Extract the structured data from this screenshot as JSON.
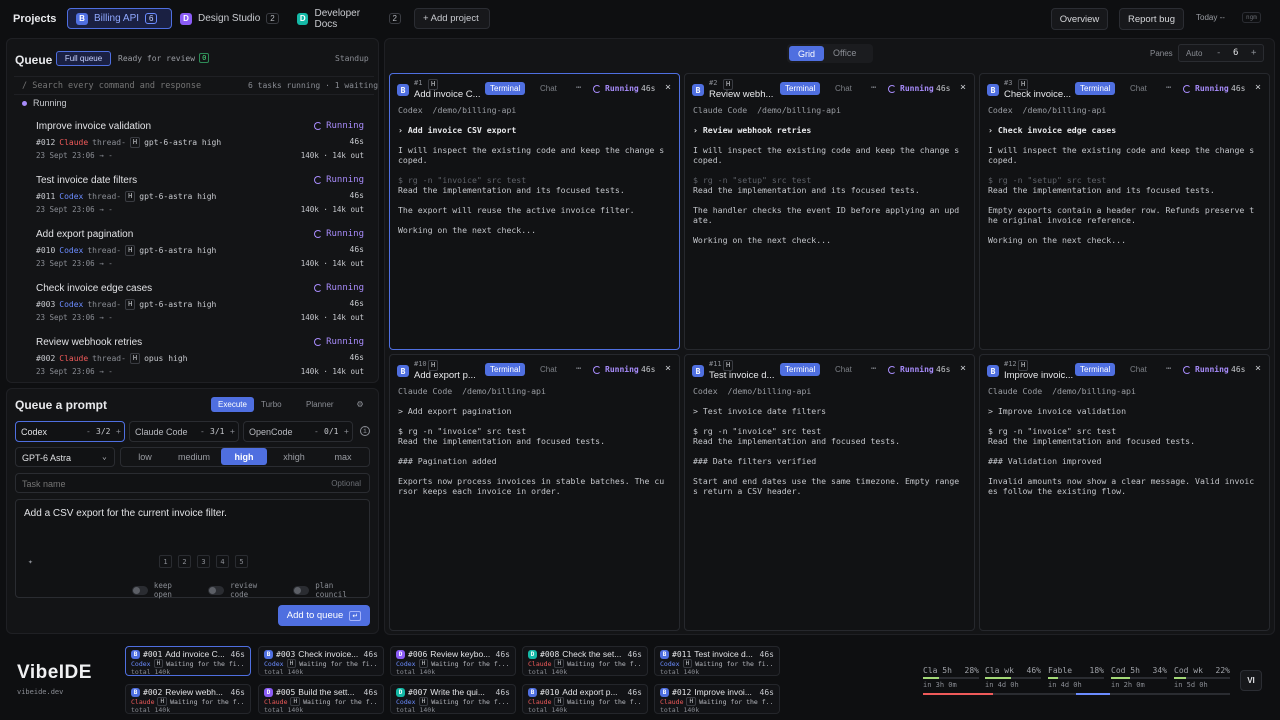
{
  "topbar": {
    "projects_label": "Projects",
    "tabs": [
      {
        "letter": "B",
        "name": "Billing API",
        "count": "6",
        "color": "#4f6fe0"
      },
      {
        "letter": "D",
        "name": "Design Studio",
        "count": "2",
        "color": "#8b5cf6"
      },
      {
        "letter": "D",
        "name": "Developer Docs",
        "count": "2",
        "color": "#14b8a6"
      }
    ],
    "add_project": "+ Add project",
    "overview": "Overview",
    "report_bug": "Report bug",
    "today": "Today --",
    "today_badge": "ngm"
  },
  "queue": {
    "title": "Queue",
    "full_queue": "Full queue",
    "ready_for_review": "Ready for review",
    "ready_count": "0",
    "standup": "Standup",
    "search_placeholder": "/ Search every command and response",
    "summary": "6 tasks running · 1 waiting",
    "section": "Running",
    "items": [
      {
        "title": "Improve invoice validation",
        "status": "Running",
        "id": "#012",
        "agent": "Claude",
        "thread": "thread-",
        "model": "gpt-6-astra high",
        "date": "23 Sept 23:06 → -",
        "time": "46s",
        "tokens": "140k · 14k out"
      },
      {
        "title": "Test invoice date filters",
        "status": "Running",
        "id": "#011",
        "agent": "Codex",
        "thread": "thread-",
        "model": "gpt-6-astra high",
        "date": "23 Sept 23:06 → -",
        "time": "46s",
        "tokens": "140k · 14k out"
      },
      {
        "title": "Add export pagination",
        "status": "Running",
        "id": "#010",
        "agent": "Codex",
        "thread": "thread-",
        "model": "gpt-6-astra high",
        "date": "23 Sept 23:06 → -",
        "time": "46s",
        "tokens": "140k · 14k out"
      },
      {
        "title": "Check invoice edge cases",
        "status": "Running",
        "id": "#003",
        "agent": "Codex",
        "thread": "thread-",
        "model": "gpt-6-astra high",
        "date": "23 Sept 23:06 → -",
        "time": "46s",
        "tokens": "140k · 14k out"
      },
      {
        "title": "Review webhook retries",
        "status": "Running",
        "id": "#002",
        "agent": "Claude",
        "thread": "thread-",
        "model": "opus high",
        "date": "23 Sept 23:06 → -",
        "time": "46s",
        "tokens": "140k · 14k out"
      }
    ]
  },
  "composer": {
    "title": "Queue a prompt",
    "modes": [
      "Execute",
      "Turbo",
      "Planner"
    ],
    "agents": [
      {
        "name": "Codex",
        "value": "3/2"
      },
      {
        "name": "Claude Code",
        "value": "3/1"
      },
      {
        "name": "OpenCode",
        "value": "0/1"
      }
    ],
    "model": "GPT-6 Astra",
    "efforts": [
      "low",
      "medium",
      "high",
      "xhigh",
      "max"
    ],
    "effort_selected": "high",
    "task_name_placeholder": "Task name",
    "optional": "Optional",
    "prompt": "Add a CSV export for the current invoice filter.",
    "counts": [
      "1",
      "2",
      "3",
      "4",
      "5"
    ],
    "toggles": [
      "keep open",
      "review code",
      "plan council"
    ],
    "submit": "Add to queue",
    "submit_key": "↵"
  },
  "grid": {
    "views": [
      "Grid",
      "Office"
    ],
    "panes_label": "Panes",
    "auto": "Auto",
    "minus": "-",
    "pane_count": "6",
    "plus": "+"
  },
  "panes": [
    {
      "id": "#1",
      "letter": "B",
      "title": "Add invoice C...",
      "status": "Running",
      "time": "46s",
      "agent": "Codex",
      "path": "/demo/billing-api",
      "lines": [
        "› Add invoice CSV export",
        "",
        "I will inspect the existing code and keep the change scoped.",
        "",
        "$ rg -n \"invoice\" src test",
        "Read the implementation and its focused tests.",
        "",
        "The export will reuse the active invoice filter.",
        "",
        "Working on the next check..."
      ]
    },
    {
      "id": "#2",
      "letter": "B",
      "title": "Review webh...",
      "status": "Running",
      "time": "46s",
      "agent": "Claude Code",
      "path": "/demo/billing-api",
      "lines": [
        "› Review webhook retries",
        "",
        "I will inspect the existing code and keep the change scoped.",
        "",
        "$ rg -n \"setup\" src test",
        "Read the implementation and its focused tests.",
        "",
        "The handler checks the event ID before applying an update.",
        "",
        "Working on the next check..."
      ]
    },
    {
      "id": "#3",
      "letter": "B",
      "title": "Check invoice...",
      "status": "Running",
      "time": "46s",
      "agent": "Codex",
      "path": "/demo/billing-api",
      "lines": [
        "› Check invoice edge cases",
        "",
        "I will inspect the existing code and keep the change scoped.",
        "",
        "$ rg -n \"setup\" src test",
        "Read the implementation and its focused tests.",
        "",
        "Empty exports contain a header row. Refunds preserve the original invoice reference.",
        "",
        "Working on the next check..."
      ]
    },
    {
      "id": "#10",
      "letter": "B",
      "title": "Add export p...",
      "status": "Running",
      "time": "46s",
      "agent": "Claude Code",
      "path": "/demo/billing-api",
      "lines": [
        "> Add export pagination",
        "",
        "$ rg -n \"invoice\" src test",
        "Read the implementation and focused tests.",
        "",
        "### Pagination added",
        "",
        "Exports now process invoices in stable batches. The cursor keeps each invoice in order."
      ]
    },
    {
      "id": "#11",
      "letter": "B",
      "title": "Test invoice d...",
      "status": "Running",
      "time": "46s",
      "agent": "Codex",
      "path": "/demo/billing-api",
      "lines": [
        "> Test invoice date filters",
        "",
        "$ rg -n \"invoice\" src test",
        "Read the implementation and focused tests.",
        "",
        "### Date filters verified",
        "",
        "Start and end dates use the same timezone. Empty ranges return a CSV header."
      ]
    },
    {
      "id": "#12",
      "letter": "B",
      "title": "Improve invoic...",
      "status": "Running",
      "time": "46s",
      "agent": "Claude Code",
      "path": "/demo/billing-api",
      "lines": [
        "> Improve invoice validation",
        "",
        "$ rg -n \"invoice\" src test",
        "Read the implementation and focused tests.",
        "",
        "### Validation improved",
        "",
        "Invalid amounts now show a clear message. Valid invoices follow the existing flow."
      ]
    }
  ],
  "pane_tabs": {
    "terminal": "Terminal",
    "chat": "Chat"
  },
  "brand": {
    "name": "VibeIDE",
    "url": "vibeide.dev"
  },
  "bottom_tasks": [
    {
      "letter": "B",
      "color": "#4f6fe0",
      "id": "#001",
      "title": "Add invoice C...",
      "time": "46s",
      "agent": "Codex",
      "msg": "Waiting for the fi...",
      "total": "total 140k"
    },
    {
      "letter": "B",
      "color": "#4f6fe0",
      "id": "#003",
      "title": "Check invoice...",
      "time": "46s",
      "agent": "Codex",
      "msg": "Waiting for the fi...",
      "total": "total 140k"
    },
    {
      "letter": "D",
      "color": "#8b5cf6",
      "id": "#006",
      "title": "Review keybo...",
      "time": "46s",
      "agent": "Codex",
      "msg": "Waiting for the f...",
      "total": "total 140k"
    },
    {
      "letter": "D",
      "color": "#14b8a6",
      "id": "#008",
      "title": "Check the set...",
      "time": "46s",
      "agent": "Claude",
      "msg": "Waiting for the f...",
      "total": "total 140k"
    },
    {
      "letter": "B",
      "color": "#4f6fe0",
      "id": "#011",
      "title": "Test invoice d...",
      "time": "46s",
      "agent": "Codex",
      "msg": "Waiting for the fi...",
      "total": "total 140k"
    },
    {
      "letter": "B",
      "color": "#4f6fe0",
      "id": "#002",
      "title": "Review webh...",
      "time": "46s",
      "agent": "Claude",
      "msg": "Waiting for the f...",
      "total": "total 140k"
    },
    {
      "letter": "D",
      "color": "#8b5cf6",
      "id": "#005",
      "title": "Build the sett...",
      "time": "46s",
      "agent": "Claude",
      "msg": "Waiting for the f...",
      "total": "total 140k"
    },
    {
      "letter": "D",
      "color": "#14b8a6",
      "id": "#007",
      "title": "Write the qui...",
      "time": "46s",
      "agent": "Codex",
      "msg": "Waiting for the f...",
      "total": "total 140k"
    },
    {
      "letter": "B",
      "color": "#4f6fe0",
      "id": "#010",
      "title": "Add export p...",
      "time": "46s",
      "agent": "Claude",
      "msg": "Waiting for the f...",
      "total": "total 140k"
    },
    {
      "letter": "B",
      "color": "#4f6fe0",
      "id": "#012",
      "title": "Improve invoi...",
      "time": "46s",
      "agent": "Claude",
      "msg": "Waiting for the f...",
      "total": "total 140k"
    }
  ],
  "usage": [
    {
      "name": "Cla 5h",
      "pct": "28%",
      "reset": "in 3h 0m",
      "fill": 0.28,
      "color": "#a3d977"
    },
    {
      "name": "Cla wk",
      "pct": "46%",
      "reset": "in 4d 0h",
      "fill": 0.46,
      "color": "#a3d977"
    },
    {
      "name": "Fable",
      "pct": "18%",
      "reset": "in 4d 0h",
      "fill": 0.18,
      "color": "#a3d977"
    },
    {
      "name": "Cod 5h",
      "pct": "34%",
      "reset": "in 2h 0m",
      "fill": 0.34,
      "color": "#a3d977"
    },
    {
      "name": "Cod wk",
      "pct": "22%",
      "reset": "in 5d 0h",
      "fill": 0.22,
      "color": "#a3d977"
    }
  ],
  "lang_button": "VI"
}
